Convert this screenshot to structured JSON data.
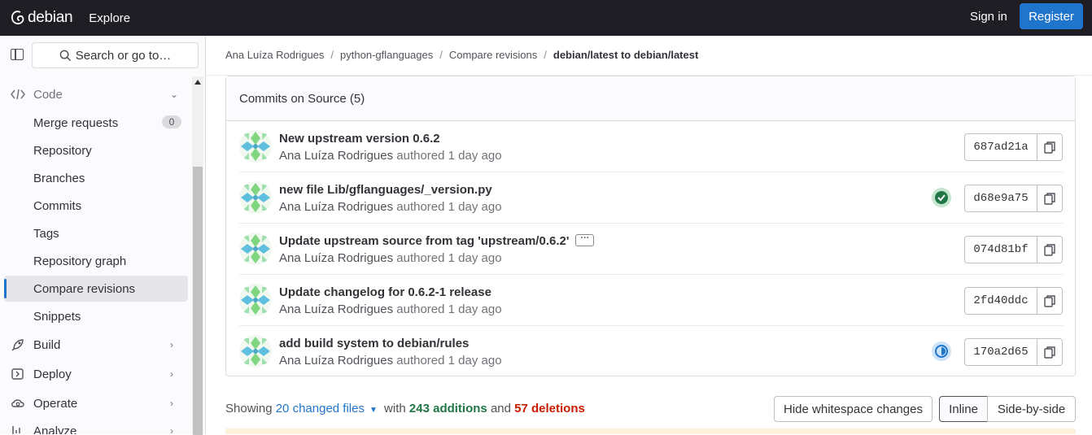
{
  "topbar": {
    "logo_text": "debian",
    "explore": "Explore",
    "sign_in": "Sign in",
    "register": "Register"
  },
  "sidebar": {
    "search_label": "Search or go to…",
    "sections": [
      {
        "label": "Code",
        "icon": "code-icon",
        "expanded": true
      },
      {
        "label": "Build",
        "icon": "rocket-icon"
      },
      {
        "label": "Deploy",
        "icon": "deploy-icon"
      },
      {
        "label": "Operate",
        "icon": "cloud-gear-icon"
      },
      {
        "label": "Analyze",
        "icon": "chart-icon"
      }
    ],
    "items": [
      {
        "label": "Merge requests",
        "badge": "0"
      },
      {
        "label": "Repository"
      },
      {
        "label": "Branches"
      },
      {
        "label": "Commits"
      },
      {
        "label": "Tags"
      },
      {
        "label": "Repository graph"
      },
      {
        "label": "Compare revisions",
        "active": true
      },
      {
        "label": "Snippets"
      }
    ]
  },
  "breadcrumb": [
    "Ana Luíza Rodrigues",
    "python-gflanguages",
    "Compare revisions",
    "debian/latest to debian/latest"
  ],
  "commits_header": "Commits on Source (5)",
  "commits": [
    {
      "title": "New upstream version 0.6.2",
      "author": "Ana Luíza Rodrigues",
      "action": "authored",
      "time": "1 day ago",
      "sha": "687ad21a",
      "status": ""
    },
    {
      "title": "new file Lib/gflanguages/_version.py",
      "author": "Ana Luíza Rodrigues",
      "action": "authored",
      "time": "1 day ago",
      "sha": "d68e9a75",
      "status": "passed"
    },
    {
      "title": "Update upstream source from tag 'upstream/0.6.2'",
      "author": "Ana Luíza Rodrigues",
      "action": "authored",
      "time": "1 day ago",
      "sha": "074d81bf",
      "status": "",
      "has_description": true
    },
    {
      "title": "Update changelog for 0.6.2-1 release",
      "author": "Ana Luíza Rodrigues",
      "action": "authored",
      "time": "1 day ago",
      "sha": "2fd40ddc",
      "status": ""
    },
    {
      "title": "add build system to debian/rules",
      "author": "Ana Luíza Rodrigues",
      "action": "authored",
      "time": "1 day ago",
      "sha": "170a2d65",
      "status": "running"
    }
  ],
  "summary": {
    "showing": "Showing",
    "files": "20 changed files",
    "with": "with",
    "additions": "243 additions",
    "and": "and",
    "deletions": "57 deletions"
  },
  "buttons": {
    "hide_whitespace": "Hide whitespace changes",
    "inline": "Inline",
    "side_by_side": "Side-by-side"
  },
  "colors": {
    "accent": "#1f75cb",
    "topbar": "#1f1e24",
    "success": "#217645",
    "danger": "#c91c00"
  }
}
